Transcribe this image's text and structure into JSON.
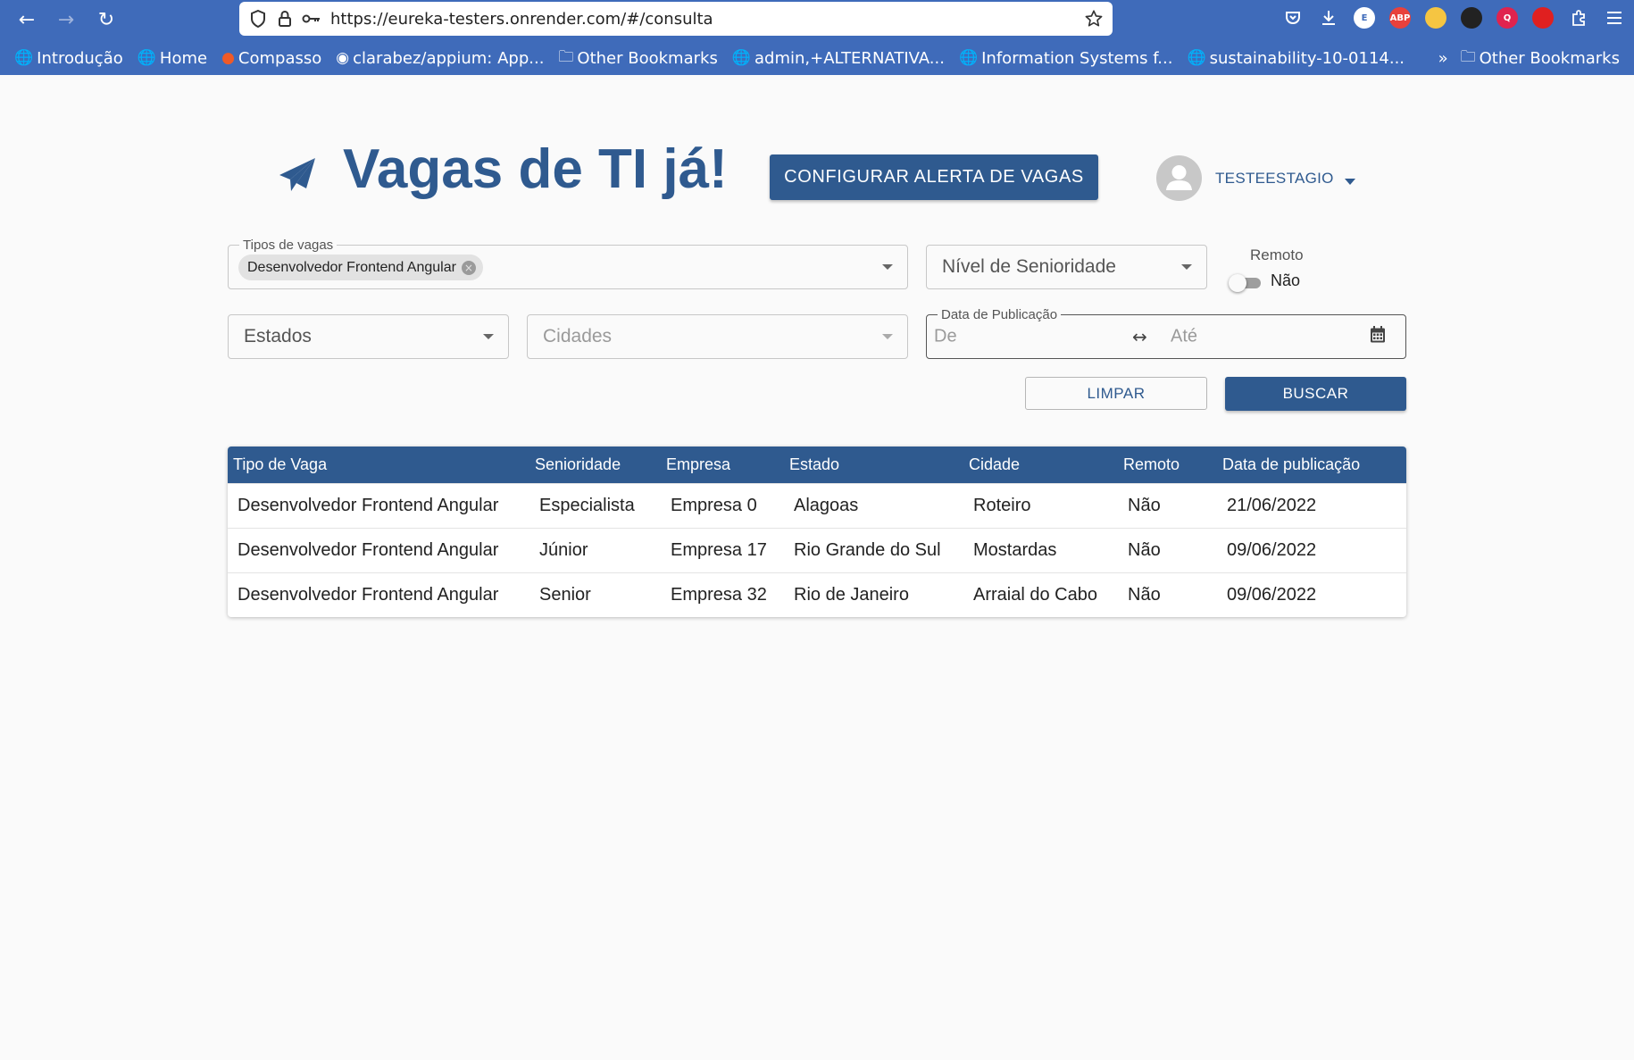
{
  "browser": {
    "url": "https://eureka-testers.onrender.com/#/consulta",
    "bookmarks": [
      {
        "label": "Introdução",
        "icon": "globe-icon"
      },
      {
        "label": "Home",
        "icon": "globe-icon"
      },
      {
        "label": "Compasso",
        "icon": "compasso-icon"
      },
      {
        "label": "clarabez/appium: App...",
        "icon": "github-icon"
      },
      {
        "label": "Other Bookmarks",
        "icon": "folder-icon"
      },
      {
        "label": "admin,+ALTERNATIVA...",
        "icon": "globe-icon"
      },
      {
        "label": "Information Systems f...",
        "icon": "globe-icon"
      },
      {
        "label": "sustainability-10-0114...",
        "icon": "globe-icon"
      }
    ],
    "bookmarks_overflow_label": "Other Bookmarks",
    "extensions": [
      {
        "name": "pocket-icon",
        "text": "",
        "color": "#ffffff"
      },
      {
        "name": "download-icon",
        "text": "",
        "color": "#ffffff"
      },
      {
        "name": "extension-e-icon",
        "text": "E",
        "color": "#ffffff"
      },
      {
        "name": "adblock-plus-icon",
        "text": "ABP",
        "color": "#e8413c"
      },
      {
        "name": "extension-emoji-icon",
        "text": "",
        "color": "#f5c542"
      },
      {
        "name": "extension-dark-icon",
        "text": "",
        "color": "#222222"
      },
      {
        "name": "extension-red-q-icon",
        "text": "Q",
        "color": "#e0234e"
      },
      {
        "name": "ublock-icon",
        "text": "",
        "color": "#e02020"
      },
      {
        "name": "extensions-puzzle-icon",
        "text": "",
        "color": "#ffffff"
      },
      {
        "name": "menu-icon",
        "text": "",
        "color": "#ffffff"
      }
    ]
  },
  "app": {
    "title": "Vagas de TI já!",
    "alert_button": "CONFIGURAR ALERTA DE VAGAS",
    "username": "TESTEESTAGIO",
    "accent_color": "#2f5a8f"
  },
  "filters": {
    "job_types": {
      "label": "Tipos de vagas",
      "selected_chip": "Desenvolvedor Frontend Angular"
    },
    "seniority": {
      "placeholder": "Nível de Senioridade"
    },
    "remote": {
      "label": "Remoto",
      "value": "Não",
      "checked": false
    },
    "states": {
      "placeholder": "Estados"
    },
    "cities": {
      "placeholder": "Cidades"
    },
    "date": {
      "label": "Data de Publicação",
      "from_placeholder": "De",
      "to_placeholder": "Até"
    },
    "clear_button": "LIMPAR",
    "search_button": "BUSCAR"
  },
  "table": {
    "columns": [
      "Tipo de Vaga",
      "Senioridade",
      "Empresa",
      "Estado",
      "Cidade",
      "Remoto",
      "Data de publicação"
    ],
    "rows": [
      [
        "Desenvolvedor Frontend Angular",
        "Especialista",
        "Empresa 0",
        "Alagoas",
        "Roteiro",
        "Não",
        "21/06/2022"
      ],
      [
        "Desenvolvedor Frontend Angular",
        "Júnior",
        "Empresa 17",
        "Rio Grande do Sul",
        "Mostardas",
        "Não",
        "09/06/2022"
      ],
      [
        "Desenvolvedor Frontend Angular",
        "Senior",
        "Empresa 32",
        "Rio de Janeiro",
        "Arraial do Cabo",
        "Não",
        "09/06/2022"
      ]
    ]
  }
}
